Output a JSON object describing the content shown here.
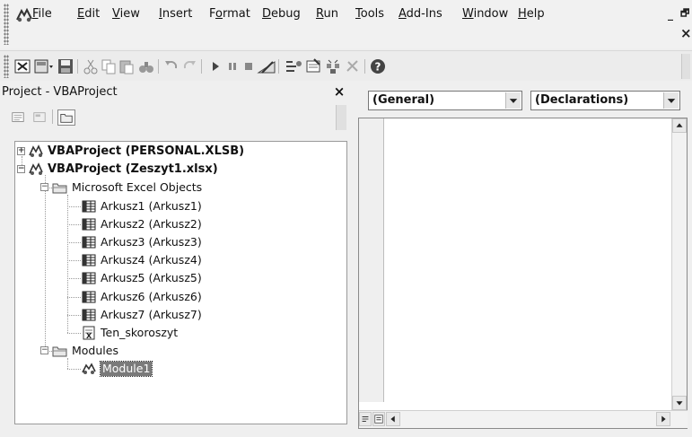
{
  "menu": {
    "items": [
      {
        "pre": "",
        "u": "F",
        "post": "ile"
      },
      {
        "pre": "",
        "u": "E",
        "post": "dit"
      },
      {
        "pre": "",
        "u": "V",
        "post": "iew"
      },
      {
        "pre": "",
        "u": "I",
        "post": "nsert"
      },
      {
        "pre": "F",
        "u": "o",
        "post": "rmat"
      },
      {
        "pre": "",
        "u": "D",
        "post": "ebug"
      },
      {
        "pre": "",
        "u": "R",
        "post": "un"
      },
      {
        "pre": "",
        "u": "T",
        "post": "ools"
      },
      {
        "pre": "",
        "u": "A",
        "post": "dd-Ins"
      },
      {
        "pre": "",
        "u": "W",
        "post": "indow"
      },
      {
        "pre": "",
        "u": "H",
        "post": "elp"
      }
    ],
    "minimize_glyph": "_",
    "restore_glyph": "🗗",
    "close_glyph": "×"
  },
  "toolbar": {
    "icons": [
      "view-excel-icon",
      "insert-module-icon",
      "save-icon",
      "cut-icon",
      "copy-icon",
      "paste-icon",
      "find-icon",
      "undo-icon",
      "redo-icon",
      "run-icon",
      "break-icon",
      "reset-icon",
      "design-mode-icon",
      "project-explorer-icon",
      "properties-icon",
      "object-browser-icon",
      "toolbox-icon",
      "help-icon"
    ]
  },
  "project": {
    "title": "Project - VBAProject",
    "close_glyph": "×",
    "tree": [
      {
        "label": "VBAProject (PERSONAL.XLSB)",
        "level": 0,
        "bold": true,
        "expander": "+",
        "icon": "vbaproject-icon"
      },
      {
        "label": "VBAProject (Zeszyt1.xlsx)",
        "level": 0,
        "bold": true,
        "expander": "-",
        "icon": "vbaproject-icon"
      },
      {
        "label": "Microsoft Excel Objects",
        "level": 1,
        "bold": false,
        "expander": "-",
        "icon": "folder-icon"
      },
      {
        "label": "Arkusz1 (Arkusz1)",
        "level": 2,
        "bold": false,
        "expander": "",
        "icon": "sheet-icon"
      },
      {
        "label": "Arkusz2 (Arkusz2)",
        "level": 2,
        "bold": false,
        "expander": "",
        "icon": "sheet-icon"
      },
      {
        "label": "Arkusz3 (Arkusz3)",
        "level": 2,
        "bold": false,
        "expander": "",
        "icon": "sheet-icon"
      },
      {
        "label": "Arkusz4 (Arkusz4)",
        "level": 2,
        "bold": false,
        "expander": "",
        "icon": "sheet-icon"
      },
      {
        "label": "Arkusz5 (Arkusz5)",
        "level": 2,
        "bold": false,
        "expander": "",
        "icon": "sheet-icon"
      },
      {
        "label": "Arkusz6 (Arkusz6)",
        "level": 2,
        "bold": false,
        "expander": "",
        "icon": "sheet-icon"
      },
      {
        "label": "Arkusz7 (Arkusz7)",
        "level": 2,
        "bold": false,
        "expander": "",
        "icon": "sheet-icon"
      },
      {
        "label": "Ten_skoroszyt",
        "level": 2,
        "bold": false,
        "expander": "",
        "icon": "workbook-icon"
      },
      {
        "label": "Modules",
        "level": 1,
        "bold": false,
        "expander": "-",
        "icon": "folder-icon"
      },
      {
        "label": "Module1",
        "level": 2,
        "bold": false,
        "expander": "",
        "icon": "module-icon",
        "selected": true
      }
    ]
  },
  "code": {
    "object_combo": "(General)",
    "procedure_combo": "(Declarations)"
  }
}
